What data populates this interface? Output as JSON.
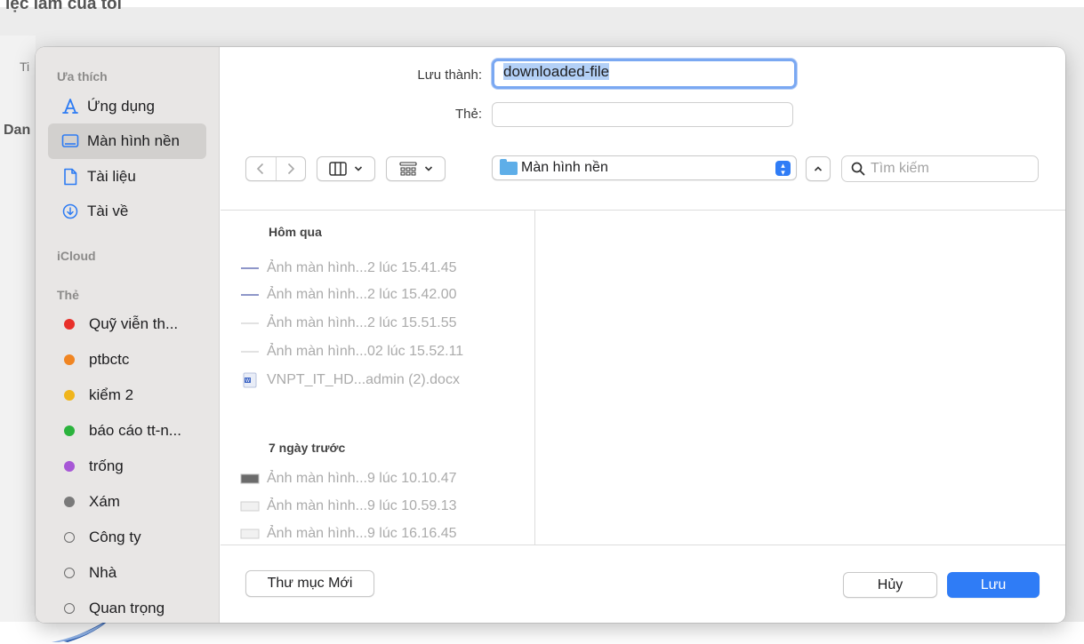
{
  "background": {
    "page_title": "iệc làm của tôi",
    "frag_left_tab": "Ti",
    "frag_section": "Dan"
  },
  "dialog": {
    "sidebar": {
      "favorites_header": "Ưa thích",
      "favorites": [
        {
          "label": "Ứng dụng",
          "icon": "applications-icon"
        },
        {
          "label": "Màn hình nền",
          "icon": "desktop-icon",
          "selected": true
        },
        {
          "label": "Tài liệu",
          "icon": "document-icon"
        },
        {
          "label": "Tài về",
          "icon": "download-icon"
        }
      ],
      "icloud_header": "iCloud",
      "tags_header": "Thẻ",
      "tags": [
        {
          "label": "Quỹ viễn th...",
          "color": "#e8302a"
        },
        {
          "label": "ptbctc",
          "color": "#f08522"
        },
        {
          "label": "kiểm 2",
          "color": "#f0b51c"
        },
        {
          "label": "báo cáo tt-n...",
          "color": "#2bb33d"
        },
        {
          "label": "trống",
          "color": "#a757d6"
        },
        {
          "label": "Xám",
          "color": "#7a7a7a"
        },
        {
          "label": "Công ty",
          "color": ""
        },
        {
          "label": "Nhà",
          "color": ""
        },
        {
          "label": "Quan trọng",
          "color": ""
        }
      ]
    },
    "form": {
      "save_as_label": "Lưu thành:",
      "save_as_value": "downloaded-file",
      "tags_label": "Thẻ:"
    },
    "toolbar": {
      "location": "Màn hình nền",
      "search_placeholder": "Tìm kiếm"
    },
    "browser": {
      "groups": [
        {
          "header": "Hôm qua",
          "files": [
            {
              "name": "Ảnh màn hình...2 lúc 15.41.45",
              "icon": "screenshot-thin-icon"
            },
            {
              "name": "Ảnh màn hình...2 lúc 15.42.00",
              "icon": "screenshot-thin-icon"
            },
            {
              "name": "Ảnh màn hình...2 lúc 15.51.55",
              "icon": "screenshot-faint-icon"
            },
            {
              "name": "Ảnh màn hình...02 lúc 15.52.11",
              "icon": "screenshot-faint-icon"
            },
            {
              "name": "VNPT_IT_HD...admin (2).docx",
              "icon": "word-doc-icon"
            }
          ]
        },
        {
          "header": "7 ngày trước",
          "files": [
            {
              "name": "Ảnh màn hình...9 lúc 10.10.47",
              "icon": "screenshot-dark-icon"
            },
            {
              "name": "Ảnh màn hình...9 lúc 10.59.13",
              "icon": "screenshot-light-icon"
            },
            {
              "name": "Ảnh màn hình...9 lúc 16.16.45",
              "icon": "screenshot-light-icon"
            }
          ]
        }
      ]
    },
    "footer": {
      "new_folder": "Thư mục Mới",
      "cancel": "Hủy",
      "save": "Lưu"
    },
    "colors": {
      "accent": "#2f7cf6",
      "focus_ring": "#7aa8f2",
      "sidebar_bg": "#e8e6e5"
    }
  }
}
